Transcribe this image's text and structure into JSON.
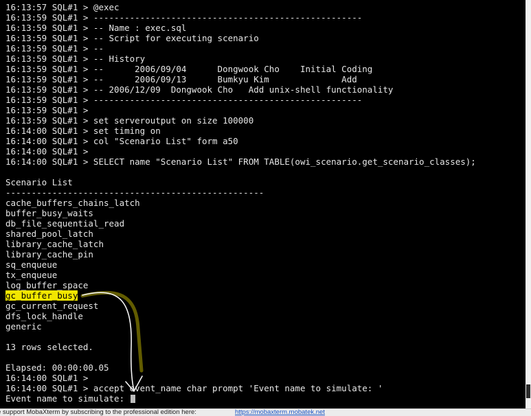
{
  "terminal": {
    "lines": [
      "16:13:57 SQL#1 > @exec",
      "16:13:59 SQL#1 > ----------------------------------------------------",
      "16:13:59 SQL#1 > -- Name : exec.sql",
      "16:13:59 SQL#1 > -- Script for executing scenario",
      "16:13:59 SQL#1 > --",
      "16:13:59 SQL#1 > -- History",
      "16:13:59 SQL#1 > --      2006/09/04      Dongwook Cho    Initial Coding",
      "16:13:59 SQL#1 > --      2006/09/13      Bumkyu Kim              Add",
      "16:13:59 SQL#1 > -- 2006/12/09  Dongwook Cho   Add unix-shell functionality",
      "16:13:59 SQL#1 > ----------------------------------------------------",
      "16:13:59 SQL#1 >",
      "16:13:59 SQL#1 > set serveroutput on size 100000",
      "16:14:00 SQL#1 > set timing on",
      "16:14:00 SQL#1 > col \"Scenario List\" form a50",
      "16:14:00 SQL#1 >",
      "16:14:00 SQL#1 > SELECT name \"Scenario List\" FROM TABLE(owi_scenario.get_scenario_classes);",
      "",
      "Scenario List",
      "--------------------------------------------------",
      "cache_buffers_chains_latch",
      "buffer_busy_waits",
      "db_file_sequential_read",
      "shared_pool_latch",
      "library_cache_latch",
      "library_cache_pin",
      "sq_enqueue",
      "tx_enqueue",
      "log_buffer_space",
      "gc_buffer_busy",
      "gc_current_request",
      "dfs_lock_handle",
      "generic",
      "",
      "13 rows selected.",
      "",
      "Elapsed: 00:00:00.05",
      "16:14:00 SQL#1 >",
      "16:14:00 SQL#1 > accept event_name char prompt 'Event name to simulate: '",
      "Event name to simulate: "
    ],
    "highlighted_line_index": 28,
    "highlight_color": "#f2e600",
    "cursor_line_index": 38
  },
  "statusbar": {
    "message": "e support MobaXterm by subscribing to the professional edition here:",
    "link": "https://mobaxterm.mobatek.net"
  },
  "colors": {
    "background": "#000000",
    "text": "#e6e6e6",
    "highlight": "#f2e600",
    "annotation_arrow": "#f5f5f5",
    "annotation_shadow": "#b3a800",
    "link": "#1a55c4"
  }
}
